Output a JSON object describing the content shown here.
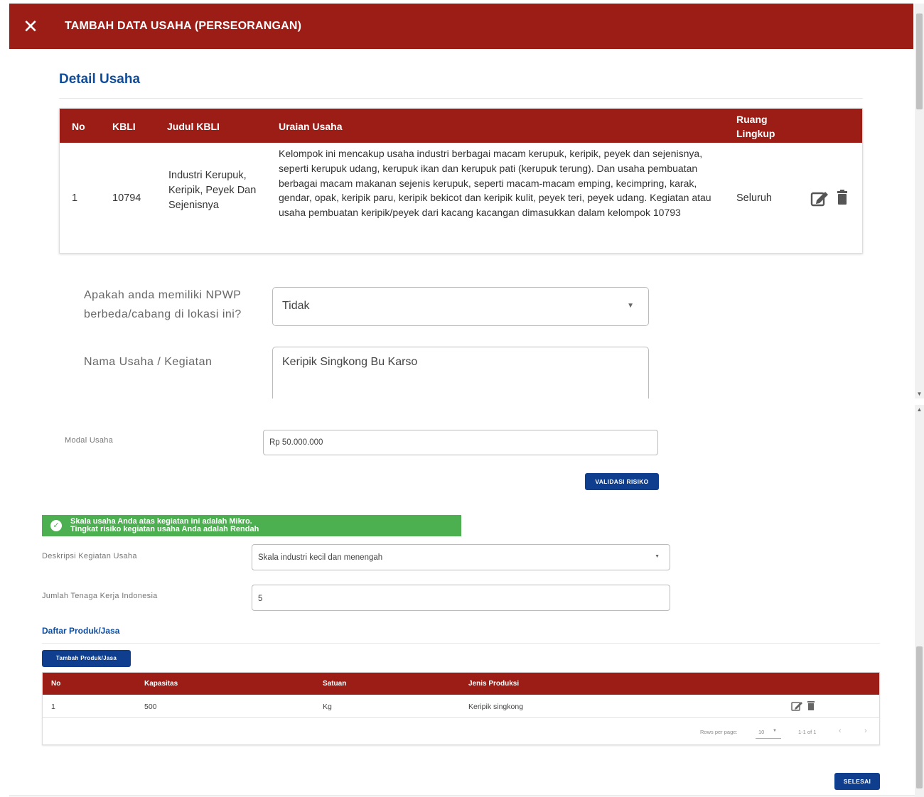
{
  "dialog": {
    "title": "TAMBAH DATA USAHA (PERSEORANGAN)",
    "close_icon": "close-icon"
  },
  "section_title": "Detail Usaha",
  "kbli_table": {
    "headers": {
      "no": "No",
      "kbli": "KBLI",
      "judul": "Judul KBLI",
      "uraian": "Uraian Usaha",
      "ruang": "Ruang Lingkup"
    },
    "rows": [
      {
        "no": "1",
        "kbli": "10794",
        "judul": "Industri Kerupuk, Keripik, Peyek Dan Sejenisnya",
        "uraian": "Kelompok ini mencakup usaha industri berbagai macam kerupuk, keripik, peyek dan sejenisnya, seperti kerupuk udang, kerupuk ikan dan kerupuk pati (kerupuk terung). Dan usaha pembuatan berbagai macam makanan sejenis kerupuk, seperti macam-macam emping, kecimpring, karak, gendar, opak, keripik paru, keripik bekicot dan keripik kulit, peyek teri, peyek udang. Kegiatan atau usaha pembuatan keripik/peyek dari kacang kacangan dimasukkan dalam kelompok 10793",
        "ruang": "Seluruh"
      }
    ]
  },
  "npwp": {
    "label": "Apakah anda memiliki NPWP berbeda/cabang di lokasi ini?",
    "value": "Tidak"
  },
  "nama_usaha": {
    "label": "Nama Usaha / Kegiatan",
    "value": "Keripik Singkong Bu Karso"
  },
  "modal": {
    "label": "Modal Usaha",
    "value": "Rp 50.000.000"
  },
  "validasi_button": "VALIDASI RISIKO",
  "alert": {
    "line1": "Skala usaha Anda atas kegiatan ini adalah Mikro.",
    "line2": "Tingkat risiko kegiatan usaha Anda adalah Rendah",
    "color": "#4caf50"
  },
  "deskripsi": {
    "label": "Deskripsi Kegiatan Usaha",
    "value": "Skala industri kecil dan menengah"
  },
  "tenaga_kerja": {
    "label": "Jumlah Tenaga Kerja Indonesia",
    "value": "5"
  },
  "produk": {
    "title": "Daftar Produk/Jasa",
    "add_button": "Tambah Produk/Jasa",
    "headers": {
      "no": "No",
      "kapasitas": "Kapasitas",
      "satuan": "Satuan",
      "jenis": "Jenis Produksi"
    },
    "rows": [
      {
        "no": "1",
        "kapasitas": "500",
        "satuan": "Kg",
        "jenis": "Keripik singkong"
      }
    ],
    "pager": {
      "rows_label": "Rows per page:",
      "rows_value": "10",
      "range": "1-1 of 1"
    }
  },
  "finish_button": "SELESAI",
  "colors": {
    "header_red": "#9b1d16",
    "primary_blue": "#0f3e8f",
    "title_blue": "#0f4c9a",
    "success_green": "#4caf50"
  }
}
